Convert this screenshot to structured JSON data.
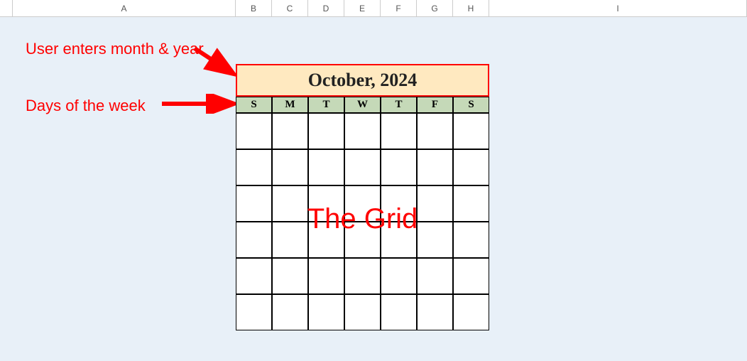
{
  "columns": [
    "A",
    "B",
    "C",
    "D",
    "E",
    "F",
    "G",
    "H",
    "I"
  ],
  "annotations": {
    "monthYear": "User enters month & year",
    "daysOfWeek": "Days of the week",
    "gridLabel": "The Grid"
  },
  "calendar": {
    "title": "October, 2024",
    "days": [
      "S",
      "M",
      "T",
      "W",
      "T",
      "F",
      "S"
    ],
    "gridRows": 6
  }
}
